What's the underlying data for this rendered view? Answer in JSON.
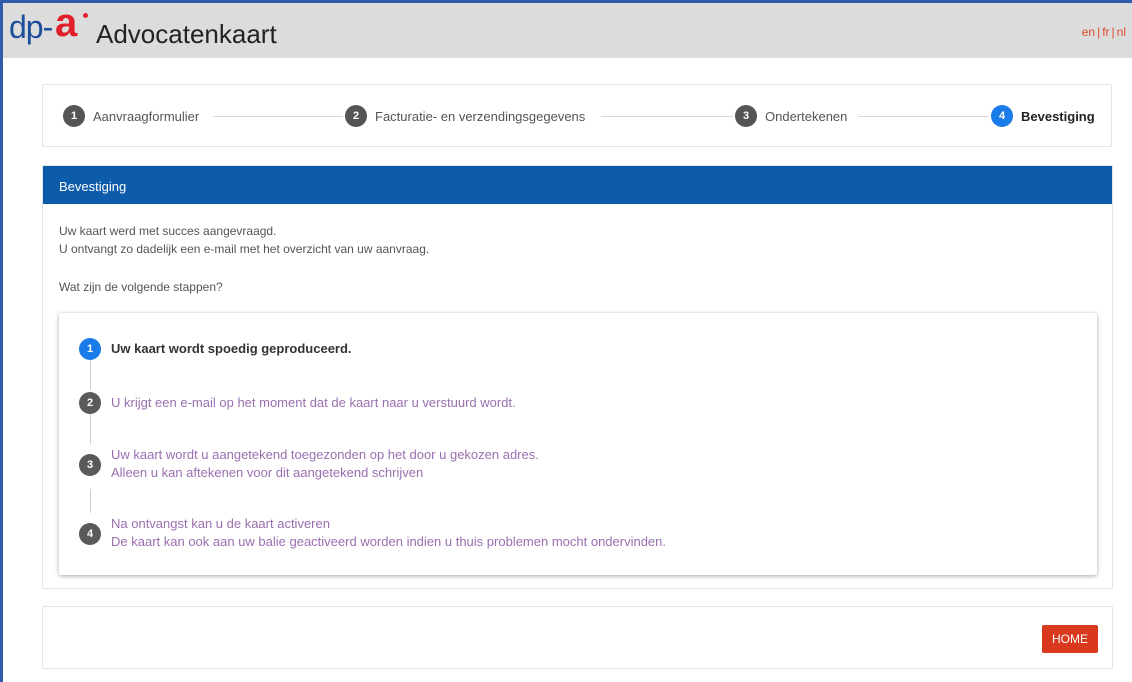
{
  "header": {
    "logo_text_dp": "dp-",
    "logo_text_a": "a",
    "title": "Advocatenkaart",
    "languages": [
      "en",
      "fr",
      "nl"
    ]
  },
  "stepper": {
    "steps": [
      {
        "number": "1",
        "label": "Aanvraagformulier",
        "active": false
      },
      {
        "number": "2",
        "label": "Facturatie- en verzendingsgegevens",
        "active": false
      },
      {
        "number": "3",
        "label": "Ondertekenen",
        "active": false
      },
      {
        "number": "4",
        "label": "Bevestiging",
        "active": true
      }
    ]
  },
  "panel": {
    "title": "Bevestiging",
    "line1": "Uw kaart werd met succes aangevraagd.",
    "line2": "U ontvangt zo dadelijk een e-mail met het overzicht van uw aanvraag.",
    "question": "Wat zijn de volgende stappen?"
  },
  "next_steps": [
    {
      "number": "1",
      "lines": [
        "Uw kaart wordt spoedig geproduceerd."
      ],
      "active": true
    },
    {
      "number": "2",
      "lines": [
        "U krijgt een e-mail op het moment dat de kaart naar u verstuurd wordt."
      ],
      "active": false
    },
    {
      "number": "3",
      "lines": [
        "Uw kaart wordt u aangetekend toegezonden op het door u gekozen adres.",
        "Alleen u kan aftekenen voor dit aangetekend schrijven"
      ],
      "active": false
    },
    {
      "number": "4",
      "lines": [
        "Na ontvangst kan u de kaart activeren",
        "De kaart kan ook aan uw balie geactiveerd worden indien u thuis problemen mocht ondervinden."
      ],
      "active": false
    }
  ],
  "footer": {
    "home_label": "HOME"
  },
  "colors": {
    "brand_blue": "#0d5bab",
    "active_step": "#1a7ce8",
    "home_button": "#d9391c",
    "language_link": "#e04a2b"
  }
}
